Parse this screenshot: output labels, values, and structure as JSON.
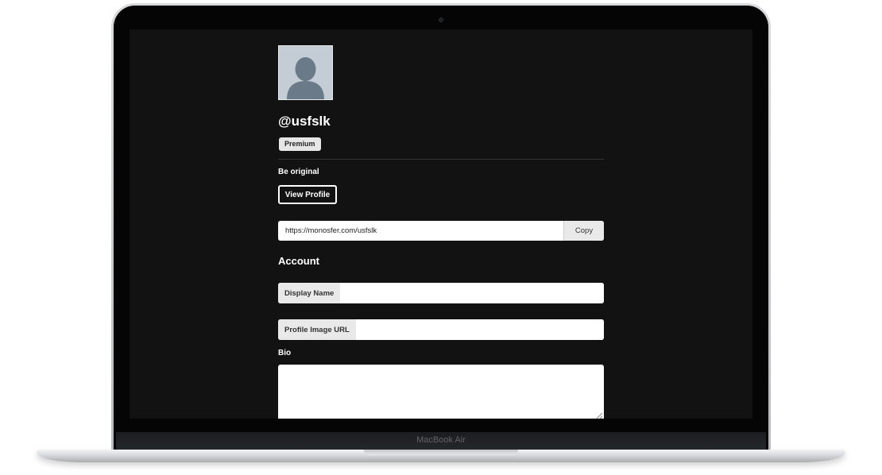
{
  "device": {
    "brand_label": "MacBook Air"
  },
  "profile": {
    "avatar_icon": "user-silhouette-icon",
    "username": "@usfslk",
    "badge": "Premium",
    "tagline": "Be original",
    "view_profile_label": "View Profile",
    "profile_url": "https://monosfer.com/usfslk",
    "copy_label": "Copy"
  },
  "account": {
    "title": "Account",
    "display_name_label": "Display Name",
    "display_name_value": "",
    "profile_image_label": "Profile Image URL",
    "profile_image_value": "",
    "bio_label": "Bio",
    "bio_value": ""
  },
  "colors": {
    "screen_bg": "#121212",
    "text": "#ffffff",
    "addon_bg": "#e9e9e9"
  }
}
